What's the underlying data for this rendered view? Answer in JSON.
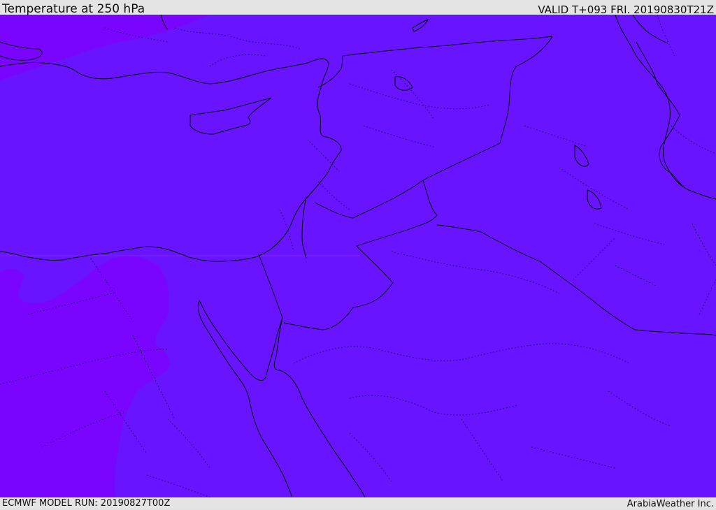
{
  "header": {
    "title": "Temperature at 250 hPa",
    "valid": "VALID T+093 FRI. 20190830T21Z"
  },
  "footer": {
    "model_run": "ECMWF MODEL RUN: 20190827T00Z",
    "credit": "ArabiaWeather Inc."
  },
  "map": {
    "field_colors": {
      "main": "#6814ff",
      "secondary": "#7a05fe",
      "outline": "#000000"
    }
  }
}
